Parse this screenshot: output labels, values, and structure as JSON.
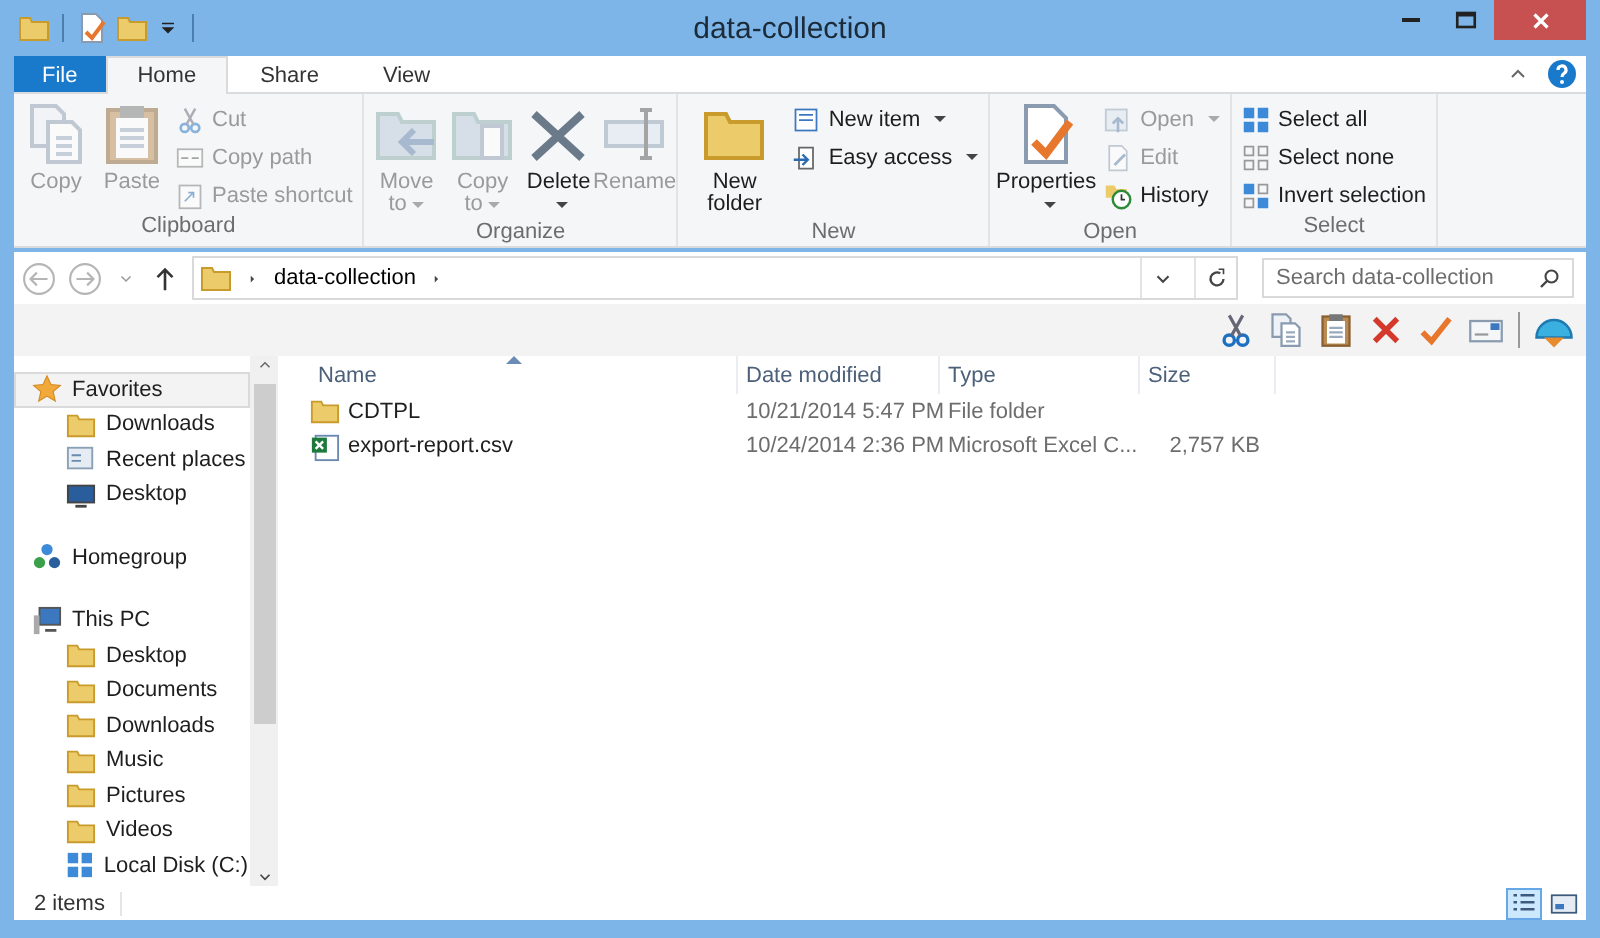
{
  "window": {
    "title": "data-collection"
  },
  "ribbon_tabs": [
    {
      "label": "File",
      "kind": "menu",
      "selected": false
    },
    {
      "label": "Home",
      "kind": "tab",
      "selected": true
    },
    {
      "label": "Share",
      "kind": "tab",
      "selected": false
    },
    {
      "label": "View",
      "kind": "tab",
      "selected": false
    }
  ],
  "ribbon_groups": [
    {
      "label": "Clipboard",
      "items": [
        {
          "label": "Copy",
          "kind": "large",
          "disabled": true,
          "dropdown": false
        },
        {
          "label": "Paste",
          "kind": "large",
          "disabled": true,
          "dropdown": false
        },
        {
          "label": "Cut",
          "kind": "small",
          "disabled": true,
          "dropdown": false
        },
        {
          "label": "Copy path",
          "kind": "small",
          "disabled": true,
          "dropdown": false
        },
        {
          "label": "Paste shortcut",
          "kind": "small",
          "disabled": true,
          "dropdown": false
        }
      ]
    },
    {
      "label": "Organize",
      "items": [
        {
          "label": "Move to",
          "kind": "large",
          "disabled": true,
          "dropdown": true
        },
        {
          "label": "Copy to",
          "kind": "large",
          "disabled": true,
          "dropdown": true
        },
        {
          "label": "Delete",
          "kind": "large",
          "disabled": false,
          "dropdown": true
        },
        {
          "label": "Rename",
          "kind": "large",
          "disabled": true,
          "dropdown": false
        }
      ]
    },
    {
      "label": "New",
      "items": [
        {
          "label": "New folder",
          "kind": "large",
          "disabled": false,
          "dropdown": false
        },
        {
          "label": "New item",
          "kind": "small",
          "disabled": false,
          "dropdown": true
        },
        {
          "label": "Easy access",
          "kind": "small",
          "disabled": false,
          "dropdown": true
        }
      ]
    },
    {
      "label": "Open",
      "items": [
        {
          "label": "Properties",
          "kind": "large",
          "disabled": false,
          "dropdown": true
        },
        {
          "label": "Open",
          "kind": "small",
          "disabled": true,
          "dropdown": true
        },
        {
          "label": "Edit",
          "kind": "small",
          "disabled": true,
          "dropdown": false
        },
        {
          "label": "History",
          "kind": "small",
          "disabled": false,
          "dropdown": false
        }
      ]
    },
    {
      "label": "Select",
      "items": [
        {
          "label": "Select all",
          "kind": "small",
          "disabled": false,
          "dropdown": false
        },
        {
          "label": "Select none",
          "kind": "small",
          "disabled": false,
          "dropdown": false
        },
        {
          "label": "Invert selection",
          "kind": "small",
          "disabled": false,
          "dropdown": false
        }
      ]
    }
  ],
  "address_bar": {
    "path": [
      "data-collection"
    ]
  },
  "search": {
    "placeholder": "Search data-collection"
  },
  "navigation": [
    {
      "label": "Favorites",
      "kind": "favorites",
      "selected": true,
      "children": [
        {
          "label": "Downloads",
          "kind": "folder",
          "selected": false
        },
        {
          "label": "Recent places",
          "kind": "recent",
          "selected": false
        },
        {
          "label": "Desktop",
          "kind": "desktop",
          "selected": false
        }
      ]
    },
    {
      "label": "Homegroup",
      "kind": "homegroup",
      "selected": false
    },
    {
      "label": "This PC",
      "kind": "computer",
      "selected": false,
      "children": [
        {
          "label": "Desktop",
          "kind": "folder",
          "selected": false
        },
        {
          "label": "Documents",
          "kind": "folder",
          "selected": false
        },
        {
          "label": "Downloads",
          "kind": "folder",
          "selected": false
        },
        {
          "label": "Music",
          "kind": "folder",
          "selected": false
        },
        {
          "label": "Pictures",
          "kind": "folder",
          "selected": false
        },
        {
          "label": "Videos",
          "kind": "folder",
          "selected": false
        },
        {
          "label": "Local Disk (C:)",
          "kind": "drive",
          "selected": false
        }
      ]
    }
  ],
  "table": {
    "columns": [
      {
        "label": "Name",
        "sorted": true
      },
      {
        "label": "Date modified",
        "sorted": false
      },
      {
        "label": "Type",
        "sorted": false
      },
      {
        "label": "Size",
        "sorted": false
      }
    ],
    "rows": [
      {
        "kind": "folder",
        "name": "CDTPL",
        "date": "10/21/2014 5:47 PM",
        "type": "File folder"
      },
      {
        "kind": "spreadsheet",
        "name": "export-report.csv",
        "date": "10/24/2014 2:36 PM",
        "type": "Microsoft Excel C...",
        "size": "2,757 KB"
      }
    ]
  },
  "status_bar": {
    "count": "2 items"
  },
  "view_buttons": [
    {
      "kind": "details",
      "selected": true
    },
    {
      "kind": "tiles",
      "selected": false
    }
  ]
}
